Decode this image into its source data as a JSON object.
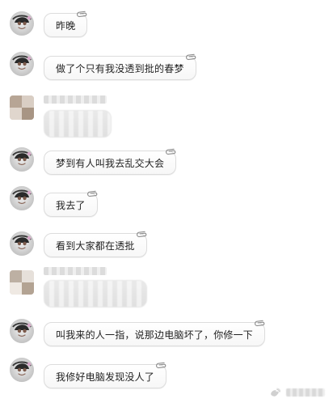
{
  "chat": {
    "messages": [
      {
        "text": "昨晚"
      },
      {
        "text": "做了个只有我没透到批的春梦"
      },
      {
        "text": "梦到有人叫我去乱交大会"
      },
      {
        "text": "我去了"
      },
      {
        "text": "看到大家都在透批"
      },
      {
        "text": "叫我来的人一指，说那边电脑坏了，你修一下"
      },
      {
        "text": "我修好电脑发现没人了"
      }
    ]
  },
  "icons": {
    "attachment": "paperclip-icon",
    "watermark_logo": "weibo-logo-icon"
  },
  "colors": {
    "bubble_border": "#dcdcdc",
    "bubble_bg": "#ffffff",
    "text": "#222222",
    "blur_gray": "#cfcfcf"
  }
}
